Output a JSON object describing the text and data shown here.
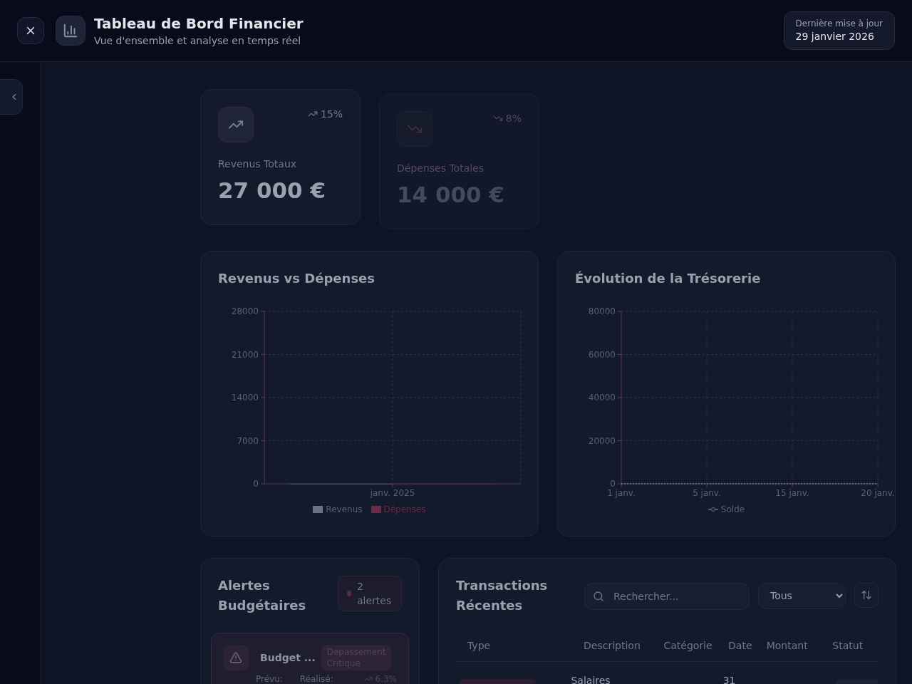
{
  "header": {
    "title": "Tableau de Bord Financier",
    "subtitle": "Vue d'ensemble et analyse en temps réel",
    "updated_label": "Dernière mise à jour",
    "updated_date": "29 janvier 2026"
  },
  "stats": [
    {
      "kind": "up",
      "change": "15%",
      "label": "Revenus Totaux",
      "value": "27 000 €"
    },
    {
      "kind": "down",
      "change": "8%",
      "label": "Dépenses Totales",
      "value": "14 000 €"
    }
  ],
  "bar_panel": {
    "title": "Revenus vs Dépenses",
    "chart_data": {
      "type": "bar",
      "categories": [
        "janv. 2025"
      ],
      "series": [
        {
          "name": "Revenus",
          "color": "#64748b",
          "values": [
            0
          ]
        },
        {
          "name": "Dépenses",
          "color": "#6b2a45",
          "values": [
            0
          ]
        }
      ],
      "ylim": [
        0,
        28000
      ],
      "yticks": [
        0,
        7000,
        14000,
        21000,
        28000
      ],
      "grid": true,
      "legend": true
    }
  },
  "line_panel": {
    "title": "Évolution de la Trésorerie",
    "chart_data": {
      "type": "line",
      "x": [
        "1 janv.",
        "5 janv.",
        "15 janv.",
        "20 janv."
      ],
      "series": [
        {
          "name": "Solde",
          "color": "#64748b",
          "values": [
            0,
            0,
            0,
            0
          ],
          "line_style": "dashed"
        }
      ],
      "ylim": [
        0,
        80000
      ],
      "yticks": [
        0,
        20000,
        40000,
        60000,
        80000
      ],
      "grid": true,
      "legend": true
    }
  },
  "alerts": {
    "title": "Alertes Budgétaires",
    "count": "2 alertes",
    "items": [
      {
        "title": "Budget ...",
        "badge": "Depassement Critique",
        "planned_label": "Prévu:",
        "actual_label": "Réalisé:",
        "change": "6.3%"
      }
    ]
  },
  "transactions": {
    "title": "Transactions Récentes",
    "search": {
      "placeholder": "Rechercher..."
    },
    "filter": "Tous",
    "columns": [
      "Type",
      "Description",
      "Catégorie",
      "Date",
      "Montant",
      "Statut"
    ],
    "rows": [
      {
        "description": "Salaires",
        "date": "31"
      }
    ]
  }
}
